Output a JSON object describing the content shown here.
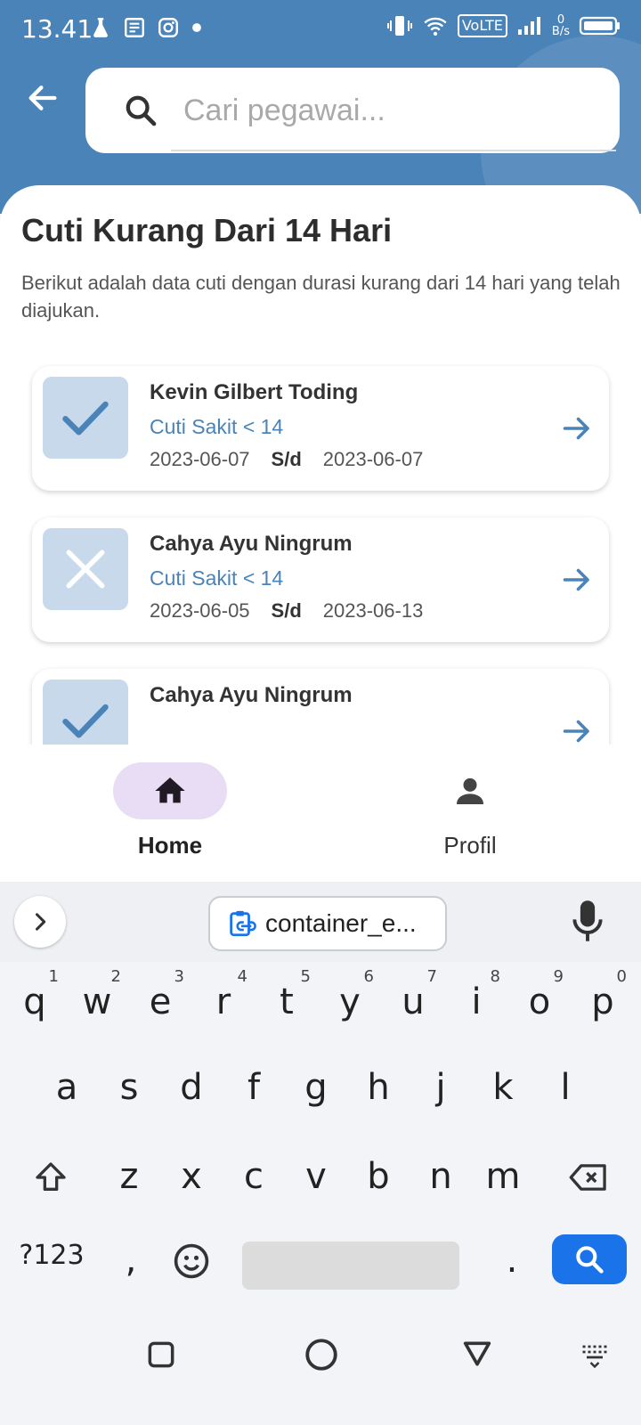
{
  "status_bar": {
    "time": "13.41",
    "volte": "VoLTE",
    "data_speed_value": "0",
    "data_speed_unit": "B/s"
  },
  "search": {
    "placeholder": "Cari pegawai..."
  },
  "page": {
    "title": "Cuti Kurang Dari 14 Hari",
    "subtitle": "Berikut adalah data cuti dengan durasi kurang dari 14 hari yang telah diajukan."
  },
  "leaves": [
    {
      "name": "Kevin Gilbert Toding",
      "type": "Cuti Sakit < 14",
      "start": "2023-06-07",
      "sep": "S/d",
      "end": "2023-06-07",
      "status_icon": "check-icon"
    },
    {
      "name": "Cahya Ayu Ningrum",
      "type": "Cuti Sakit < 14",
      "start": "2023-06-05",
      "sep": "S/d",
      "end": "2023-06-13",
      "status_icon": "x-icon"
    },
    {
      "name": "Cahya Ayu Ningrum",
      "type": "",
      "start": "",
      "sep": "",
      "end": "",
      "status_icon": "check-icon"
    }
  ],
  "bottom_nav": {
    "home": "Home",
    "profil": "Profil"
  },
  "keyboard": {
    "clipboard": "container_e...",
    "row1": [
      "q",
      "w",
      "e",
      "r",
      "t",
      "y",
      "u",
      "i",
      "o",
      "p"
    ],
    "row1_hints": [
      "1",
      "2",
      "3",
      "4",
      "5",
      "6",
      "7",
      "8",
      "9",
      "0"
    ],
    "row2": [
      "a",
      "s",
      "d",
      "f",
      "g",
      "h",
      "j",
      "k",
      "l"
    ],
    "row3": [
      "z",
      "x",
      "c",
      "v",
      "b",
      "n",
      "m"
    ],
    "symbols": "?123",
    "comma": ",",
    "period": "."
  },
  "colors": {
    "primary": "#4a83b8",
    "card_status_bg": "#c7d9ea",
    "nav_active": "#e8ddf5",
    "search_key": "#1a73e8"
  }
}
